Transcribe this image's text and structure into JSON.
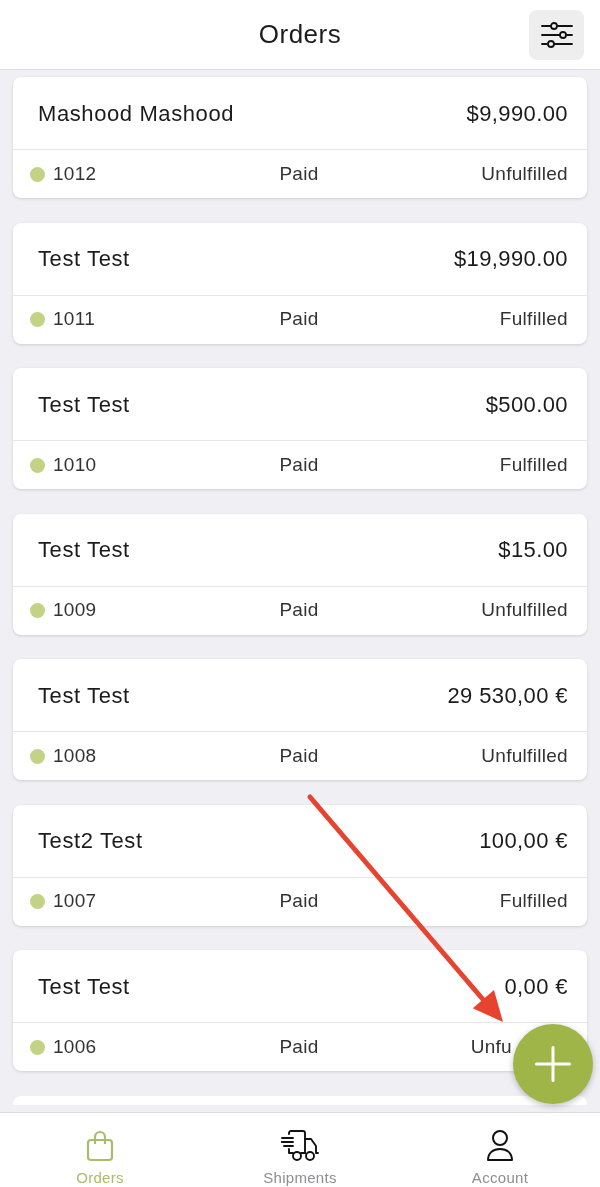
{
  "header": {
    "title": "Orders"
  },
  "orders": [
    {
      "customer": "Mashood Mashood",
      "total": "$9,990.00",
      "number": "1012",
      "payment": "Paid",
      "fulfillment": "Unfulfilled",
      "clipped": false
    },
    {
      "customer": "Test Test",
      "total": "$19,990.00",
      "number": "1011",
      "payment": "Paid",
      "fulfillment": "Fulfilled",
      "clipped": false
    },
    {
      "customer": "Test Test",
      "total": "$500.00",
      "number": "1010",
      "payment": "Paid",
      "fulfillment": "Fulfilled",
      "clipped": false
    },
    {
      "customer": "Test Test",
      "total": "$15.00",
      "number": "1009",
      "payment": "Paid",
      "fulfillment": "Unfulfilled",
      "clipped": false
    },
    {
      "customer": "Test Test",
      "total": "29 530,00 €",
      "number": "1008",
      "payment": "Paid",
      "fulfillment": "Unfulfilled",
      "clipped": false
    },
    {
      "customer": "Test2 Test",
      "total": "100,00 €",
      "number": "1007",
      "payment": "Paid",
      "fulfillment": "Fulfilled",
      "clipped": false
    },
    {
      "customer": "Test Test",
      "total": "0,00 €",
      "number": "1006",
      "payment": "Paid",
      "fulfillment": "Unfu",
      "clipped": true
    }
  ],
  "tab_bar": [
    {
      "kind": "orders",
      "label": "Orders",
      "selected": true
    },
    {
      "kind": "shipments",
      "label": "Shipments",
      "selected": false
    },
    {
      "kind": "account",
      "label": "Account",
      "selected": false
    }
  ]
}
